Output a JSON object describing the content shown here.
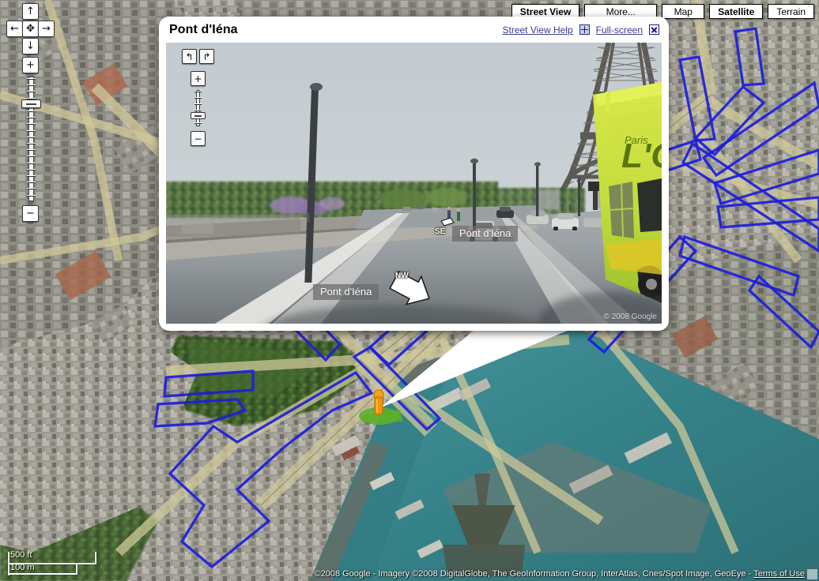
{
  "map": {
    "type_buttons": [
      {
        "label": "Street View",
        "selected": true,
        "wide": false
      },
      {
        "label": "More...",
        "selected": false,
        "wide": true
      },
      {
        "label": "Map",
        "selected": false,
        "wide": false
      },
      {
        "label": "Satellite",
        "selected": true,
        "wide": false
      },
      {
        "label": "Terrain",
        "selected": false,
        "wide": false
      }
    ],
    "pan_controls": {
      "up": "↑",
      "left": "←",
      "center": "✥",
      "right": "→",
      "down": "↓",
      "zoom_in": "+",
      "zoom_out": "−"
    },
    "scale": {
      "imperial": "500 ft",
      "metric": "100 m"
    },
    "attribution": "©2008 Google - Imagery ©2008 DigitalGlobe, The GeoInformation Group, InterAtlas, Cnes/Spot Image, GeoEye - ",
    "terms_label": "Terms of Use",
    "marker": {
      "name": "pegman-marker",
      "color": "#f59a11"
    },
    "coverage_color": "#1d1ddd",
    "water_color": "#3a8f94"
  },
  "streetview": {
    "title": "Pont d'Iéna",
    "help_link": "Street View Help",
    "fullscreen_link": "Full-screen",
    "copyright": "© 2008 Google",
    "controls": {
      "rotate_left": "↰",
      "rotate_right": "↱",
      "zoom_in": "+",
      "zoom_out": "−"
    },
    "road_labels": [
      {
        "text": "Pont d'Iéna",
        "direction": "SE"
      },
      {
        "text": "Pont d'Iéna",
        "direction": "NW"
      }
    ]
  }
}
